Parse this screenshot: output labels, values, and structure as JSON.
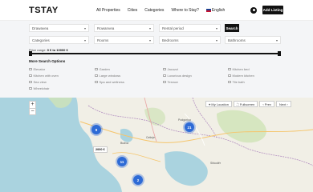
{
  "header": {
    "logo": "TSTAY",
    "nav": [
      "All Properties",
      "Cities",
      "Categories",
      "Where to Stay?"
    ],
    "language": "English",
    "add_listing": "Add Listing"
  },
  "search": {
    "destination": "Drawavea",
    "checkin": "Rowanvea",
    "rental_period": "Rental period",
    "button": "Search",
    "categories": "Categories",
    "rooms": "Rooms",
    "bedrooms": "Bedrooms",
    "bathrooms": "Bathrooms",
    "price_label": "Price range:",
    "price_value": "0 € to 10000 €",
    "price_range": [
      0,
      10000
    ],
    "more_title": "More Search Options"
  },
  "options": [
    [
      "Elevator",
      "Garden",
      "Jacuzzi",
      "Kitchen bed"
    ],
    [
      "Kitchen with oven",
      "Large windows",
      "Luxurious design",
      "Modern kitchen"
    ],
    [
      "Sea view",
      "Spa and wellness",
      "Terrace",
      "Tile bath"
    ],
    [
      "Wheelchair"
    ]
  ],
  "map": {
    "zoom_in": "+",
    "zoom_out": "−",
    "my_location": "My Location",
    "fullscreen": "Fullscreen",
    "prev": "Prev",
    "next": "Next",
    "clusters": [
      "9",
      "21",
      "11",
      "2"
    ],
    "price_tag": "2000 €",
    "cities": [
      "Budva",
      "Cetinje",
      "Shkodër",
      "Podgorica"
    ]
  }
}
